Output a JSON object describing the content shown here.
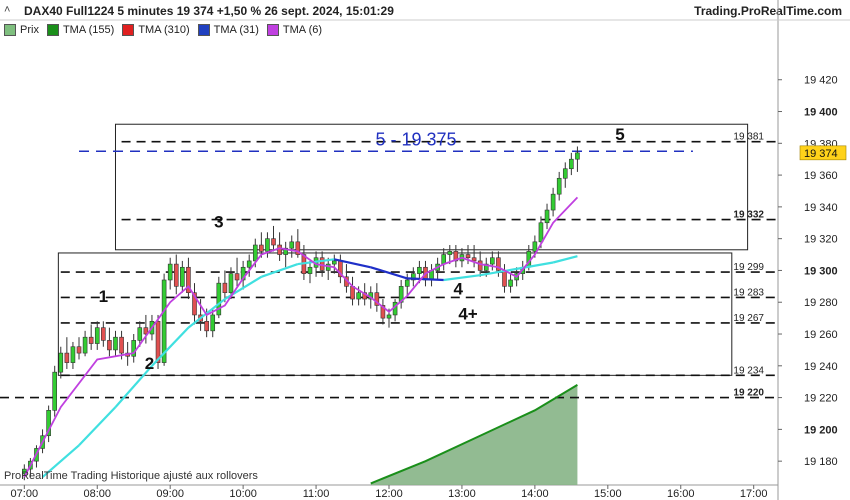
{
  "header": {
    "title": "DAX40 Full1224 5 minutes 19 374 +1,50 % 26 sept. 2024, 15:01:29",
    "site": "Trading.ProRealTime.com",
    "collapse_glyph": "˄"
  },
  "legend": [
    {
      "label": "Prix",
      "color": "#7fbf7f"
    },
    {
      "label": "TMA (155)",
      "color": "#1a8f1a"
    },
    {
      "label": "TMA (310)",
      "color": "#e02020"
    },
    {
      "label": "TMA (31)",
      "color": "#2040c0"
    },
    {
      "label": "TMA (6)",
      "color": "#c040e0"
    }
  ],
  "footer_note": "ProRealTime Trading Historique ajusté aux rollovers",
  "colors": {
    "bull": "#33cc33",
    "bear": "#e05050",
    "wave_label": "#111111",
    "tma6": "#c040e0",
    "tma31_up": "#40e0e0",
    "tma31_down": "#1f2fc8",
    "tma155": "#1a8f1a",
    "tma155_fill": "#86b486",
    "target_line": "#2030c0",
    "price_tag_bg": "#ffd21a"
  },
  "chart_data": {
    "type": "candlestick",
    "ylim": [
      19165,
      19445
    ],
    "xlim": [
      "06:40",
      "17:20"
    ],
    "x_ticks": [
      "07:00",
      "08:00",
      "09:00",
      "10:00",
      "11:00",
      "12:00",
      "13:00",
      "14:00",
      "15:00",
      "16:00",
      "17:00"
    ],
    "y_ticks": [
      {
        "value": 19420,
        "label": "19 420"
      },
      {
        "value": 19400,
        "label": "19 400"
      },
      {
        "value": 19380,
        "label": "19 380"
      },
      {
        "value": 19360,
        "label": "19 360"
      },
      {
        "value": 19340,
        "label": "19 340"
      },
      {
        "value": 19320,
        "label": "19 320"
      },
      {
        "value": 19300,
        "label": "19 300"
      },
      {
        "value": 19280,
        "label": "19 280"
      },
      {
        "value": 19260,
        "label": "19 260"
      },
      {
        "value": 19240,
        "label": "19 240"
      },
      {
        "value": 19220,
        "label": "19 220"
      },
      {
        "value": 19200,
        "label": "19 200"
      },
      {
        "value": 19180,
        "label": "19 180"
      }
    ],
    "bold_ticks": [
      19400,
      19300,
      19200
    ],
    "levels": [
      {
        "value": 19381,
        "label": "19 381",
        "x_from": "08:20",
        "x_to": "16:30",
        "bold": false
      },
      {
        "value": 19332,
        "label": "19 332",
        "x_from": "08:20",
        "x_to": "16:30",
        "bold": true
      },
      {
        "value": 19299,
        "label": "19 299",
        "x_from": "07:30",
        "x_to": "16:30",
        "bold": false
      },
      {
        "value": 19283,
        "label": "19 283",
        "x_from": "07:30",
        "x_to": "16:30",
        "bold": false
      },
      {
        "value": 19267,
        "label": "19 267",
        "x_from": "07:30",
        "x_to": "16:30",
        "bold": false
      },
      {
        "value": 19234,
        "label": "19 234",
        "x_from": "07:30",
        "x_to": "16:30",
        "bold": false
      },
      {
        "value": 19220,
        "label": "19 220",
        "x_from": "06:40",
        "x_to": "16:30",
        "bold": true
      }
    ],
    "target": {
      "value": 19375,
      "label": "5 - 19 375",
      "x_from": "07:45",
      "x_to": "16:10"
    },
    "boxes": [
      {
        "x_from": "08:15",
        "x_to": "16:55",
        "y_from": 19313,
        "y_to": 19392
      },
      {
        "x_from": "07:28",
        "x_to": "16:42",
        "y_from": 19234,
        "y_to": 19311
      }
    ],
    "wave_labels": [
      {
        "text": "1",
        "time": "08:05",
        "value": 19280
      },
      {
        "text": "2",
        "time": "08:43",
        "value": 19238
      },
      {
        "text": "3",
        "time": "09:40",
        "value": 19327
      },
      {
        "text": "4",
        "time": "12:57",
        "value": 19285
      },
      {
        "text": "4+",
        "time": "13:05",
        "value": 19269
      },
      {
        "text": "5",
        "time": "15:10",
        "value": 19382
      }
    ],
    "last_price": {
      "value": 19374,
      "label": "19 374"
    },
    "candles": [
      {
        "t": "07:00",
        "o": 19172,
        "h": 19178,
        "l": 19168,
        "c": 19175
      },
      {
        "t": "07:05",
        "o": 19175,
        "h": 19182,
        "l": 19170,
        "c": 19180
      },
      {
        "t": "07:10",
        "o": 19180,
        "h": 19190,
        "l": 19176,
        "c": 19188
      },
      {
        "t": "07:15",
        "o": 19188,
        "h": 19200,
        "l": 19185,
        "c": 19196
      },
      {
        "t": "07:20",
        "o": 19196,
        "h": 19215,
        "l": 19192,
        "c": 19212
      },
      {
        "t": "07:25",
        "o": 19212,
        "h": 19240,
        "l": 19208,
        "c": 19236
      },
      {
        "t": "07:30",
        "o": 19236,
        "h": 19252,
        "l": 19232,
        "c": 19248
      },
      {
        "t": "07:35",
        "o": 19248,
        "h": 19258,
        "l": 19238,
        "c": 19242
      },
      {
        "t": "07:40",
        "o": 19242,
        "h": 19255,
        "l": 19238,
        "c": 19252
      },
      {
        "t": "07:45",
        "o": 19252,
        "h": 19258,
        "l": 19244,
        "c": 19248
      },
      {
        "t": "07:50",
        "o": 19248,
        "h": 19262,
        "l": 19246,
        "c": 19258
      },
      {
        "t": "07:55",
        "o": 19258,
        "h": 19266,
        "l": 19250,
        "c": 19254
      },
      {
        "t": "08:00",
        "o": 19254,
        "h": 19268,
        "l": 19250,
        "c": 19264
      },
      {
        "t": "08:05",
        "o": 19264,
        "h": 19268,
        "l": 19252,
        "c": 19256
      },
      {
        "t": "08:10",
        "o": 19256,
        "h": 19264,
        "l": 19246,
        "c": 19250
      },
      {
        "t": "08:15",
        "o": 19250,
        "h": 19262,
        "l": 19246,
        "c": 19258
      },
      {
        "t": "08:20",
        "o": 19258,
        "h": 19262,
        "l": 19244,
        "c": 19248
      },
      {
        "t": "08:25",
        "o": 19248,
        "h": 19255,
        "l": 19240,
        "c": 19246
      },
      {
        "t": "08:30",
        "o": 19246,
        "h": 19260,
        "l": 19242,
        "c": 19256
      },
      {
        "t": "08:35",
        "o": 19256,
        "h": 19268,
        "l": 19252,
        "c": 19264
      },
      {
        "t": "08:40",
        "o": 19264,
        "h": 19272,
        "l": 19254,
        "c": 19260
      },
      {
        "t": "08:45",
        "o": 19260,
        "h": 19272,
        "l": 19256,
        "c": 19268
      },
      {
        "t": "08:50",
        "o": 19268,
        "h": 19272,
        "l": 19238,
        "c": 19242
      },
      {
        "t": "08:55",
        "o": 19242,
        "h": 19298,
        "l": 19240,
        "c": 19294
      },
      {
        "t": "09:00",
        "o": 19294,
        "h": 19308,
        "l": 19288,
        "c": 19304
      },
      {
        "t": "09:05",
        "o": 19304,
        "h": 19310,
        "l": 19285,
        "c": 19290
      },
      {
        "t": "09:10",
        "o": 19290,
        "h": 19306,
        "l": 19286,
        "c": 19302
      },
      {
        "t": "09:15",
        "o": 19302,
        "h": 19308,
        "l": 19282,
        "c": 19286
      },
      {
        "t": "09:20",
        "o": 19286,
        "h": 19292,
        "l": 19266,
        "c": 19272
      },
      {
        "t": "09:25",
        "o": 19272,
        "h": 19282,
        "l": 19262,
        "c": 19268
      },
      {
        "t": "09:30",
        "o": 19268,
        "h": 19276,
        "l": 19258,
        "c": 19262
      },
      {
        "t": "09:35",
        "o": 19262,
        "h": 19276,
        "l": 19258,
        "c": 19272
      },
      {
        "t": "09:40",
        "o": 19272,
        "h": 19296,
        "l": 19270,
        "c": 19292
      },
      {
        "t": "09:45",
        "o": 19292,
        "h": 19300,
        "l": 19280,
        "c": 19286
      },
      {
        "t": "09:50",
        "o": 19286,
        "h": 19302,
        "l": 19282,
        "c": 19298
      },
      {
        "t": "09:55",
        "o": 19298,
        "h": 19308,
        "l": 19290,
        "c": 19294
      },
      {
        "t": "10:00",
        "o": 19294,
        "h": 19306,
        "l": 19288,
        "c": 19302
      },
      {
        "t": "10:05",
        "o": 19302,
        "h": 19310,
        "l": 19296,
        "c": 19306
      },
      {
        "t": "10:10",
        "o": 19306,
        "h": 19320,
        "l": 19302,
        "c": 19316
      },
      {
        "t": "10:15",
        "o": 19316,
        "h": 19324,
        "l": 19308,
        "c": 19312
      },
      {
        "t": "10:20",
        "o": 19312,
        "h": 19324,
        "l": 19308,
        "c": 19320
      },
      {
        "t": "10:25",
        "o": 19320,
        "h": 19328,
        "l": 19312,
        "c": 19316
      },
      {
        "t": "10:30",
        "o": 19316,
        "h": 19324,
        "l": 19306,
        "c": 19310
      },
      {
        "t": "10:35",
        "o": 19310,
        "h": 19318,
        "l": 19302,
        "c": 19314
      },
      {
        "t": "10:40",
        "o": 19314,
        "h": 19322,
        "l": 19308,
        "c": 19318
      },
      {
        "t": "10:45",
        "o": 19318,
        "h": 19326,
        "l": 19308,
        "c": 19310
      },
      {
        "t": "10:50",
        "o": 19310,
        "h": 19316,
        "l": 19294,
        "c": 19298
      },
      {
        "t": "10:55",
        "o": 19298,
        "h": 19306,
        "l": 19292,
        "c": 19302
      },
      {
        "t": "11:00",
        "o": 19302,
        "h": 19312,
        "l": 19296,
        "c": 19308
      },
      {
        "t": "11:05",
        "o": 19308,
        "h": 19312,
        "l": 19296,
        "c": 19300
      },
      {
        "t": "11:10",
        "o": 19300,
        "h": 19308,
        "l": 19294,
        "c": 19304
      },
      {
        "t": "11:15",
        "o": 19304,
        "h": 19310,
        "l": 19298,
        "c": 19306
      },
      {
        "t": "11:20",
        "o": 19306,
        "h": 19310,
        "l": 19292,
        "c": 19296
      },
      {
        "t": "11:25",
        "o": 19296,
        "h": 19304,
        "l": 19286,
        "c": 19290
      },
      {
        "t": "11:30",
        "o": 19290,
        "h": 19296,
        "l": 19278,
        "c": 19282
      },
      {
        "t": "11:35",
        "o": 19282,
        "h": 19290,
        "l": 19278,
        "c": 19286
      },
      {
        "t": "11:40",
        "o": 19286,
        "h": 19292,
        "l": 19278,
        "c": 19282
      },
      {
        "t": "11:45",
        "o": 19282,
        "h": 19290,
        "l": 19276,
        "c": 19286
      },
      {
        "t": "11:50",
        "o": 19286,
        "h": 19292,
        "l": 19274,
        "c": 19278
      },
      {
        "t": "11:55",
        "o": 19278,
        "h": 19282,
        "l": 19266,
        "c": 19270
      },
      {
        "t": "12:00",
        "o": 19270,
        "h": 19276,
        "l": 19264,
        "c": 19272
      },
      {
        "t": "12:05",
        "o": 19272,
        "h": 19282,
        "l": 19268,
        "c": 19280
      },
      {
        "t": "12:10",
        "o": 19280,
        "h": 19294,
        "l": 19276,
        "c": 19290
      },
      {
        "t": "12:15",
        "o": 19290,
        "h": 19298,
        "l": 19284,
        "c": 19294
      },
      {
        "t": "12:20",
        "o": 19294,
        "h": 19302,
        "l": 19290,
        "c": 19298
      },
      {
        "t": "12:25",
        "o": 19298,
        "h": 19306,
        "l": 19292,
        "c": 19302
      },
      {
        "t": "12:30",
        "o": 19302,
        "h": 19306,
        "l": 19290,
        "c": 19294
      },
      {
        "t": "12:35",
        "o": 19294,
        "h": 19304,
        "l": 19290,
        "c": 19300
      },
      {
        "t": "12:40",
        "o": 19300,
        "h": 19308,
        "l": 19294,
        "c": 19304
      },
      {
        "t": "12:45",
        "o": 19304,
        "h": 19314,
        "l": 19300,
        "c": 19310
      },
      {
        "t": "12:50",
        "o": 19310,
        "h": 19316,
        "l": 19304,
        "c": 19312
      },
      {
        "t": "12:55",
        "o": 19312,
        "h": 19316,
        "l": 19302,
        "c": 19306
      },
      {
        "t": "13:00",
        "o": 19306,
        "h": 19314,
        "l": 19302,
        "c": 19310
      },
      {
        "t": "13:05",
        "o": 19310,
        "h": 19316,
        "l": 19304,
        "c": 19308
      },
      {
        "t": "13:10",
        "o": 19308,
        "h": 19316,
        "l": 19302,
        "c": 19306
      },
      {
        "t": "13:15",
        "o": 19306,
        "h": 19312,
        "l": 19296,
        "c": 19300
      },
      {
        "t": "13:20",
        "o": 19300,
        "h": 19308,
        "l": 19296,
        "c": 19304
      },
      {
        "t": "13:25",
        "o": 19304,
        "h": 19312,
        "l": 19300,
        "c": 19308
      },
      {
        "t": "13:30",
        "o": 19308,
        "h": 19312,
        "l": 19296,
        "c": 19300
      },
      {
        "t": "13:35",
        "o": 19300,
        "h": 19304,
        "l": 19286,
        "c": 19290
      },
      {
        "t": "13:40",
        "o": 19290,
        "h": 19298,
        "l": 19286,
        "c": 19294
      },
      {
        "t": "13:45",
        "o": 19294,
        "h": 19302,
        "l": 19290,
        "c": 19298
      },
      {
        "t": "13:50",
        "o": 19298,
        "h": 19306,
        "l": 19294,
        "c": 19302
      },
      {
        "t": "13:55",
        "o": 19302,
        "h": 19316,
        "l": 19300,
        "c": 19312
      },
      {
        "t": "14:00",
        "o": 19312,
        "h": 19322,
        "l": 19308,
        "c": 19318
      },
      {
        "t": "14:05",
        "o": 19318,
        "h": 19334,
        "l": 19314,
        "c": 19330
      },
      {
        "t": "14:10",
        "o": 19330,
        "h": 19342,
        "l": 19326,
        "c": 19338
      },
      {
        "t": "14:15",
        "o": 19338,
        "h": 19352,
        "l": 19334,
        "c": 19348
      },
      {
        "t": "14:20",
        "o": 19348,
        "h": 19362,
        "l": 19344,
        "c": 19358
      },
      {
        "t": "14:25",
        "o": 19358,
        "h": 19368,
        "l": 19352,
        "c": 19364
      },
      {
        "t": "14:30",
        "o": 19364,
        "h": 19374,
        "l": 19360,
        "c": 19370
      },
      {
        "t": "14:35",
        "o": 19370,
        "h": 19378,
        "l": 19362,
        "c": 19374
      }
    ],
    "tma6": [
      {
        "t": "07:00",
        "v": 19170
      },
      {
        "t": "07:30",
        "v": 19214
      },
      {
        "t": "08:00",
        "v": 19244
      },
      {
        "t": "08:30",
        "v": 19248
      },
      {
        "t": "09:00",
        "v": 19280
      },
      {
        "t": "09:15",
        "v": 19290
      },
      {
        "t": "09:30",
        "v": 19272
      },
      {
        "t": "09:45",
        "v": 19278
      },
      {
        "t": "10:00",
        "v": 19295
      },
      {
        "t": "10:15",
        "v": 19310
      },
      {
        "t": "10:30",
        "v": 19314
      },
      {
        "t": "10:45",
        "v": 19312
      },
      {
        "t": "11:00",
        "v": 19304
      },
      {
        "t": "11:15",
        "v": 19302
      },
      {
        "t": "11:30",
        "v": 19290
      },
      {
        "t": "11:45",
        "v": 19283
      },
      {
        "t": "12:00",
        "v": 19274
      },
      {
        "t": "12:15",
        "v": 19284
      },
      {
        "t": "12:30",
        "v": 19298
      },
      {
        "t": "12:45",
        "v": 19304
      },
      {
        "t": "13:00",
        "v": 19308
      },
      {
        "t": "13:15",
        "v": 19304
      },
      {
        "t": "13:30",
        "v": 19302
      },
      {
        "t": "13:45",
        "v": 19296
      },
      {
        "t": "14:00",
        "v": 19310
      },
      {
        "t": "14:15",
        "v": 19330
      },
      {
        "t": "14:35",
        "v": 19346
      }
    ],
    "tma31": [
      {
        "t": "07:15",
        "v": 19170
      },
      {
        "t": "07:45",
        "v": 19190
      },
      {
        "t": "08:15",
        "v": 19214
      },
      {
        "t": "08:45",
        "v": 19240
      },
      {
        "t": "09:15",
        "v": 19264
      },
      {
        "t": "09:45",
        "v": 19282
      },
      {
        "t": "10:15",
        "v": 19296
      },
      {
        "t": "10:45",
        "v": 19304
      },
      {
        "t": "11:15",
        "v": 19307
      },
      {
        "t": "11:45",
        "v": 19302
      },
      {
        "t": "12:15",
        "v": 19295
      },
      {
        "t": "12:45",
        "v": 19294
      },
      {
        "t": "13:15",
        "v": 19297
      },
      {
        "t": "13:45",
        "v": 19301
      },
      {
        "t": "14:15",
        "v": 19305
      },
      {
        "t": "14:35",
        "v": 19309
      }
    ],
    "tma155": [
      {
        "t": "11:45",
        "v": 19166
      },
      {
        "t": "12:30",
        "v": 19180
      },
      {
        "t": "13:15",
        "v": 19196
      },
      {
        "t": "14:00",
        "v": 19212
      },
      {
        "t": "14:35",
        "v": 19228
      }
    ]
  }
}
